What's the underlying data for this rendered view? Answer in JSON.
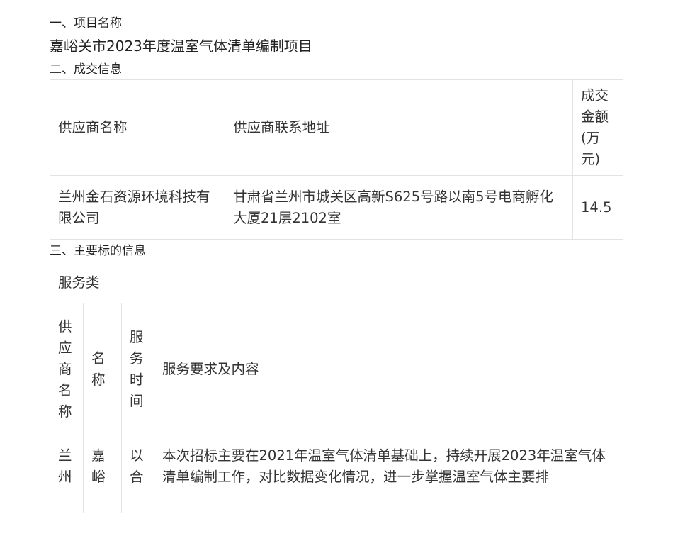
{
  "section1": {
    "heading": "一、项目名称",
    "project_name": "嘉峪关市2023年度温室气体清单编制项目"
  },
  "section2": {
    "heading": "二、成交信息",
    "headers": [
      "供应商名称",
      "供应商联系地址",
      "成交金额(万元)"
    ],
    "row": {
      "supplier": "兰州金石资源环境科技有限公司",
      "address": "甘肃省兰州市城关区高新S625号路以南5号电商孵化大厦21层2102室",
      "amount": "14.5"
    }
  },
  "section3": {
    "heading": "三、主要标的信息",
    "category": "服务类",
    "headers": [
      "供应商名称",
      "名称",
      "服务时间",
      "服务要求及内容"
    ],
    "row": {
      "supplier": "兰州",
      "name": "嘉峪",
      "time": "以合",
      "content": "本次招标主要在2021年温室气体清单基础上，持续开展2023年温室气体清单编制工作，对比数据变化情况，进一步掌握温室气体主要排"
    }
  }
}
